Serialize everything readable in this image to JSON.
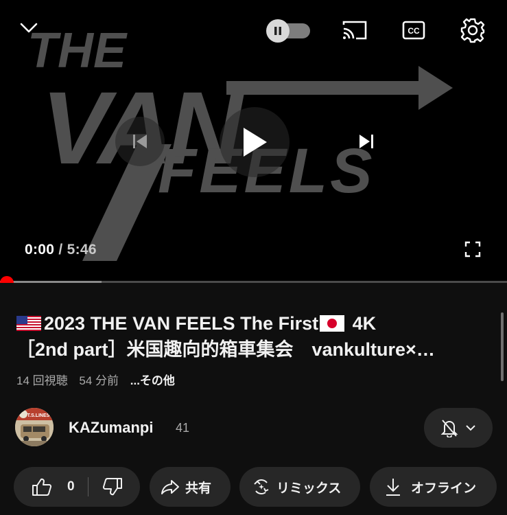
{
  "player": {
    "current_time": "0:00",
    "separator": "/",
    "duration": "5:46",
    "progress_fraction": 0.0,
    "buffered_fraction": 0.2,
    "thumbnail_text": {
      "line1": "THE",
      "line2": "VAN",
      "line3": "FEELS"
    },
    "icons": {
      "collapse": "chevron-down-icon",
      "autoplay": "pause-icon",
      "cast": "cast-icon",
      "captions": "cc-icon",
      "settings": "gear-icon",
      "previous": "skip-previous-icon",
      "play": "play-icon",
      "next": "skip-next-icon",
      "fullscreen": "fullscreen-icon"
    },
    "colors": {
      "progress": "#ff0000",
      "logo": "#7a7a7a"
    }
  },
  "video": {
    "title_line1": "2023 THE VAN FEELS The First",
    "title_line1_suffix": "4K",
    "title_line2": "［2nd part］米国趣向的箱車集会　vankulture×…",
    "views": "14 回視聴",
    "age": "54 分前",
    "more": "...その他"
  },
  "channel": {
    "name": "KAZumanpi",
    "subscribers": "41",
    "avatar_text": "T.S.LINES"
  },
  "actions": {
    "like_count": "0",
    "share_label": "共有",
    "remix_label": "リミックス",
    "offline_label": "オフライン"
  }
}
